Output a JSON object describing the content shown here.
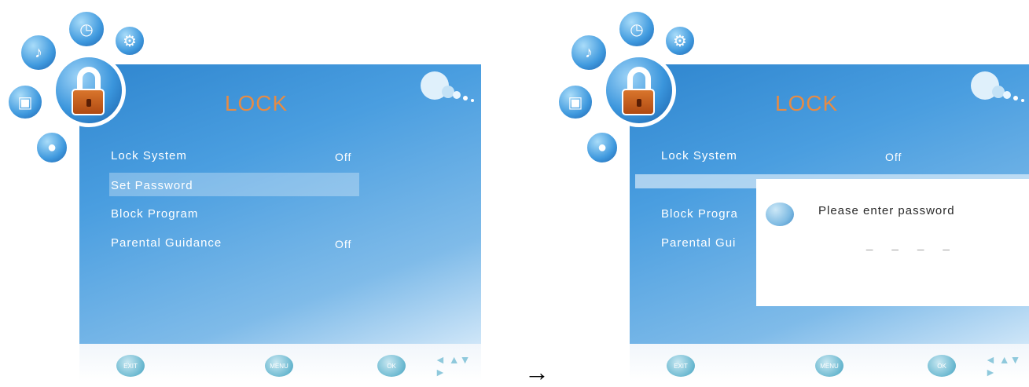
{
  "left": {
    "title": "LOCK",
    "items": [
      {
        "label": "Lock System",
        "value": "Off"
      },
      {
        "label": "Set Password",
        "value": ""
      },
      {
        "label": "Block Program",
        "value": ""
      },
      {
        "label": "Parental Guidance",
        "value": "Off"
      }
    ],
    "selected_index": 1,
    "buttons": {
      "exit": "EXIT",
      "menu": "MENU",
      "ok": "OK"
    }
  },
  "right": {
    "title": "LOCK",
    "items": [
      {
        "label": "Lock System",
        "value": "Off"
      },
      {
        "label": "Block Progra",
        "value": ""
      },
      {
        "label": "Parental Gui",
        "value": ""
      }
    ],
    "dialog": {
      "message": "Please enter password",
      "dashes": "_ _ _ _"
    },
    "buttons": {
      "exit": "EXIT",
      "menu": "MENU",
      "ok": "OK"
    }
  },
  "transition_arrow": "→",
  "icons": [
    "music-icon",
    "clock-icon",
    "gear-icon",
    "picture-icon",
    "lock-icon",
    "chat-icon",
    "bubbles-logo",
    "direction-arrows-icon"
  ]
}
